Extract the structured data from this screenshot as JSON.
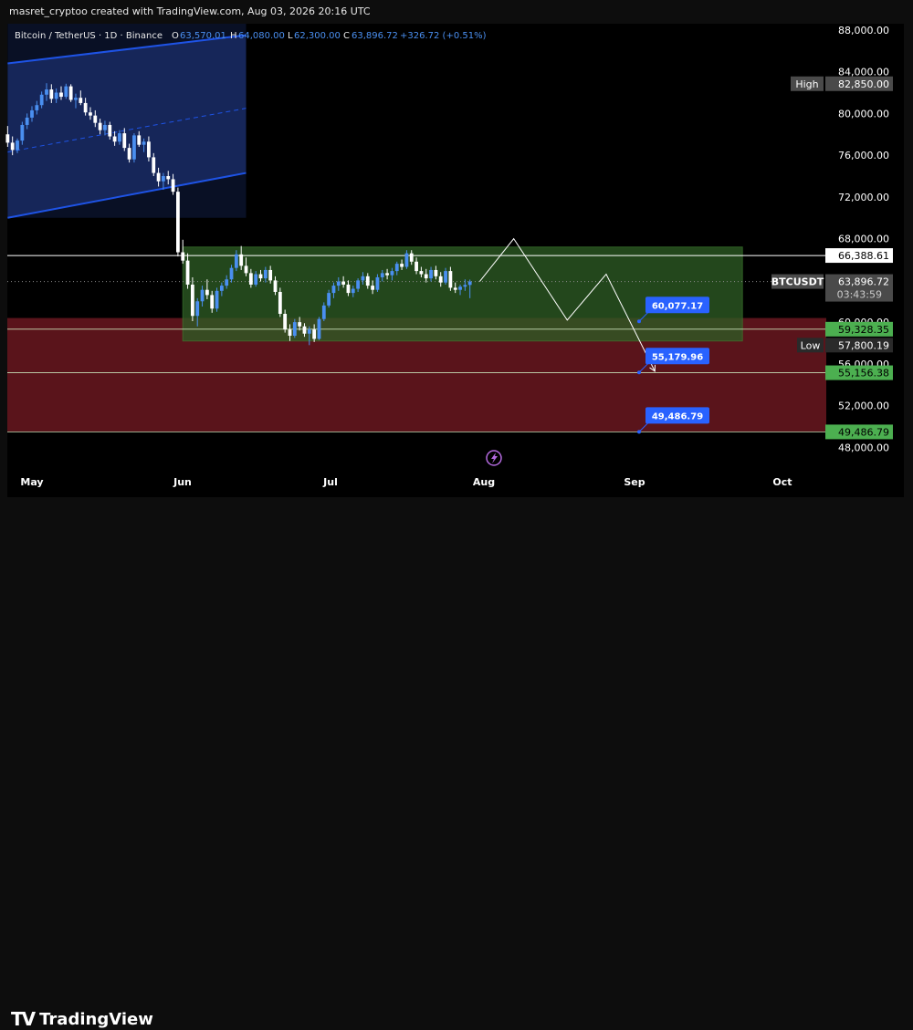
{
  "credit": "masret_cryptoo created with TradingView.com, Aug 03, 2026 20:16 UTC",
  "legend": {
    "symbol": "Bitcoin / TetherUS · 1D · Binance",
    "o_label": "O",
    "o_value": "63,570.01",
    "h_label": "H",
    "h_value": "64,080.00",
    "l_label": "L",
    "l_value": "62,300.00",
    "c_label": "C",
    "c_value": "63,896.72",
    "change": "+326.72 (+0.51%)"
  },
  "logo_text": "TradingView",
  "colors": {
    "bull": "#4a8ff0",
    "bear": "#ffffff",
    "channel": "#1e53e5",
    "range_box": "#2e5b24",
    "red_zone": "#6a1820",
    "price_label_green": "#4caf50",
    "callout_blue": "#2962ff"
  },
  "chart_data": {
    "type": "candlestick",
    "x_ticks": [
      "May",
      "Jun",
      "Jul",
      "Aug",
      "Sep",
      "Oct"
    ],
    "y_ticks": [
      "88,000.00",
      "84,000.00",
      "80,000.00",
      "76,000.00",
      "72,000.00",
      "68,000.00",
      "60,000.00",
      "56,000.00",
      "52,000.00",
      "48,000.00"
    ],
    "ylim": [
      46200,
      88600
    ],
    "price_labels": [
      {
        "tag": "High",
        "value": "82,850.00",
        "price": 82850,
        "style": "grey"
      },
      {
        "tag": "",
        "value": "66,388.61",
        "price": 66388.61,
        "style": "white"
      },
      {
        "tag": "BTCUSDT",
        "value": "63,896.72",
        "sub": "03:43:59",
        "price": 63896.72,
        "style": "grey"
      },
      {
        "tag": "",
        "value": "59,328.35",
        "price": 59328.35,
        "style": "green"
      },
      {
        "tag": "Low",
        "value": "57,800.19",
        "price": 57800.19,
        "style": "dark"
      },
      {
        "tag": "",
        "value": "55,156.38",
        "price": 55156.38,
        "style": "green"
      },
      {
        "tag": "",
        "value": "49,486.79",
        "price": 49486.79,
        "style": "green"
      }
    ],
    "horizontal_lines": [
      66388.61,
      59328.35,
      55156.38,
      49486.79
    ],
    "callouts": [
      {
        "text": "60,077.17",
        "price": 60077.17
      },
      {
        "text": "55,179.96",
        "price": 55179.96
      },
      {
        "text": "49,486.79",
        "price": 49486.79
      }
    ],
    "range_box": {
      "top": 67200,
      "bottom": 58200,
      "start": "Jun 01",
      "end": "Sep 24"
    },
    "red_zone": {
      "top": 60400,
      "bottom": 49486.79
    },
    "channel": {
      "upper": [
        [
          "Apr 26",
          84800
        ],
        [
          "Jun 14",
          87500
        ]
      ],
      "mid": [
        [
          "Apr 26",
          76300
        ],
        [
          "Jun 14",
          80500
        ]
      ],
      "lower": [
        [
          "Apr 26",
          70000
        ],
        [
          "Jun 14",
          74300
        ]
      ]
    },
    "projection": [
      [
        "Aug 01",
        63900
      ],
      [
        "Aug 08",
        68000
      ],
      [
        "Aug 19",
        60200
      ],
      [
        "Aug 27",
        64600
      ],
      [
        "Sep 06",
        55300
      ]
    ],
    "candles": [
      [
        78000,
        78800,
        76800,
        77200
      ],
      [
        77200,
        77800,
        76000,
        76500
      ],
      [
        76500,
        77600,
        76200,
        77400
      ],
      [
        77400,
        79200,
        77000,
        78900
      ],
      [
        78900,
        80000,
        78500,
        79600
      ],
      [
        79600,
        80700,
        79200,
        80300
      ],
      [
        80300,
        81200,
        79900,
        80800
      ],
      [
        80800,
        82100,
        80500,
        81800
      ],
      [
        81800,
        82900,
        81200,
        82300
      ],
      [
        82300,
        82800,
        81000,
        81400
      ],
      [
        81400,
        82400,
        81000,
        82000
      ],
      [
        82000,
        82600,
        81300,
        81600
      ],
      [
        81600,
        82850,
        81400,
        82600
      ],
      [
        82600,
        82800,
        81100,
        81300
      ],
      [
        81300,
        81900,
        80500,
        81500
      ],
      [
        81500,
        82200,
        80800,
        81000
      ],
      [
        81000,
        81500,
        79800,
        80100
      ],
      [
        80100,
        80600,
        79400,
        79800
      ],
      [
        79800,
        80300,
        78700,
        79100
      ],
      [
        79100,
        79500,
        78000,
        78400
      ],
      [
        78400,
        79300,
        77900,
        78900
      ],
      [
        78900,
        79200,
        77500,
        77800
      ],
      [
        77800,
        78300,
        76900,
        77300
      ],
      [
        77300,
        78400,
        77000,
        78100
      ],
      [
        78100,
        78600,
        76400,
        76700
      ],
      [
        76700,
        77100,
        75300,
        75600
      ],
      [
        75600,
        78100,
        75300,
        77900
      ],
      [
        77900,
        78300,
        76800,
        77000
      ],
      [
        77000,
        77600,
        76300,
        77300
      ],
      [
        77300,
        77800,
        75400,
        75800
      ],
      [
        75800,
        76200,
        74000,
        74300
      ],
      [
        74300,
        74800,
        73000,
        73500
      ],
      [
        73500,
        74300,
        72700,
        74000
      ],
      [
        74000,
        74500,
        73200,
        73700
      ],
      [
        73700,
        74200,
        72200,
        72500
      ],
      [
        72500,
        72900,
        66300,
        66700
      ],
      [
        66700,
        67900,
        65600,
        65900
      ],
      [
        65900,
        66600,
        63200,
        63600
      ],
      [
        63600,
        64300,
        60100,
        60600
      ],
      [
        60600,
        62300,
        59600,
        62000
      ],
      [
        62000,
        63500,
        61500,
        63100
      ],
      [
        63100,
        64100,
        62200,
        62600
      ],
      [
        62600,
        63000,
        60900,
        61300
      ],
      [
        61300,
        63300,
        61000,
        63000
      ],
      [
        63000,
        63800,
        62500,
        63500
      ],
      [
        63500,
        64500,
        63200,
        64100
      ],
      [
        64100,
        65500,
        63800,
        65200
      ],
      [
        65200,
        66900,
        64900,
        66500
      ],
      [
        66500,
        67300,
        65000,
        65400
      ],
      [
        65400,
        66200,
        64400,
        64700
      ],
      [
        64700,
        65100,
        63300,
        63600
      ],
      [
        63600,
        64900,
        63400,
        64600
      ],
      [
        64600,
        65000,
        63900,
        64200
      ],
      [
        64200,
        65300,
        63800,
        65000
      ],
      [
        65000,
        65400,
        63700,
        64000
      ],
      [
        64000,
        64400,
        62600,
        62900
      ],
      [
        62900,
        63300,
        60500,
        60800
      ],
      [
        60800,
        61200,
        59000,
        59300
      ],
      [
        59300,
        59800,
        58200,
        58700
      ],
      [
        58700,
        60300,
        58500,
        60000
      ],
      [
        60000,
        60500,
        59200,
        59600
      ],
      [
        59600,
        59900,
        58600,
        58900
      ],
      [
        58900,
        59600,
        57800,
        59300
      ],
      [
        59300,
        59800,
        58100,
        58400
      ],
      [
        58400,
        60500,
        58300,
        60300
      ],
      [
        60300,
        61900,
        60100,
        61600
      ],
      [
        61600,
        63100,
        61400,
        62800
      ],
      [
        62800,
        63800,
        62300,
        63500
      ],
      [
        63500,
        64300,
        63000,
        63900
      ],
      [
        63900,
        64400,
        63300,
        63600
      ],
      [
        63600,
        64000,
        62500,
        62800
      ],
      [
        62800,
        63500,
        62400,
        63200
      ],
      [
        63200,
        64200,
        62900,
        64000
      ],
      [
        64000,
        64800,
        63600,
        64400
      ],
      [
        64400,
        64700,
        63200,
        63500
      ],
      [
        63500,
        64000,
        62700,
        63100
      ],
      [
        63100,
        64600,
        62900,
        64300
      ],
      [
        64300,
        65000,
        63900,
        64700
      ],
      [
        64700,
        65100,
        64100,
        64500
      ],
      [
        64500,
        65200,
        64000,
        64900
      ],
      [
        64900,
        65800,
        64500,
        65600
      ],
      [
        65600,
        66000,
        65000,
        65300
      ],
      [
        65300,
        66900,
        65100,
        66600
      ],
      [
        66600,
        66900,
        65500,
        65800
      ],
      [
        65800,
        66200,
        64600,
        64900
      ],
      [
        64900,
        65300,
        64300,
        64600
      ],
      [
        64600,
        65100,
        63800,
        64200
      ],
      [
        64200,
        65300,
        63900,
        65000
      ],
      [
        65000,
        65400,
        64100,
        64400
      ],
      [
        64400,
        64800,
        63400,
        63800
      ],
      [
        63800,
        65200,
        63600,
        64900
      ],
      [
        64900,
        65300,
        63000,
        63300
      ],
      [
        63300,
        63800,
        62800,
        63100
      ],
      [
        63100,
        63600,
        62600,
        63400
      ],
      [
        63400,
        64100,
        63000,
        63570
      ],
      [
        63570,
        64080,
        62300,
        63896.72
      ]
    ],
    "first_candle_date": "Apr 26"
  }
}
